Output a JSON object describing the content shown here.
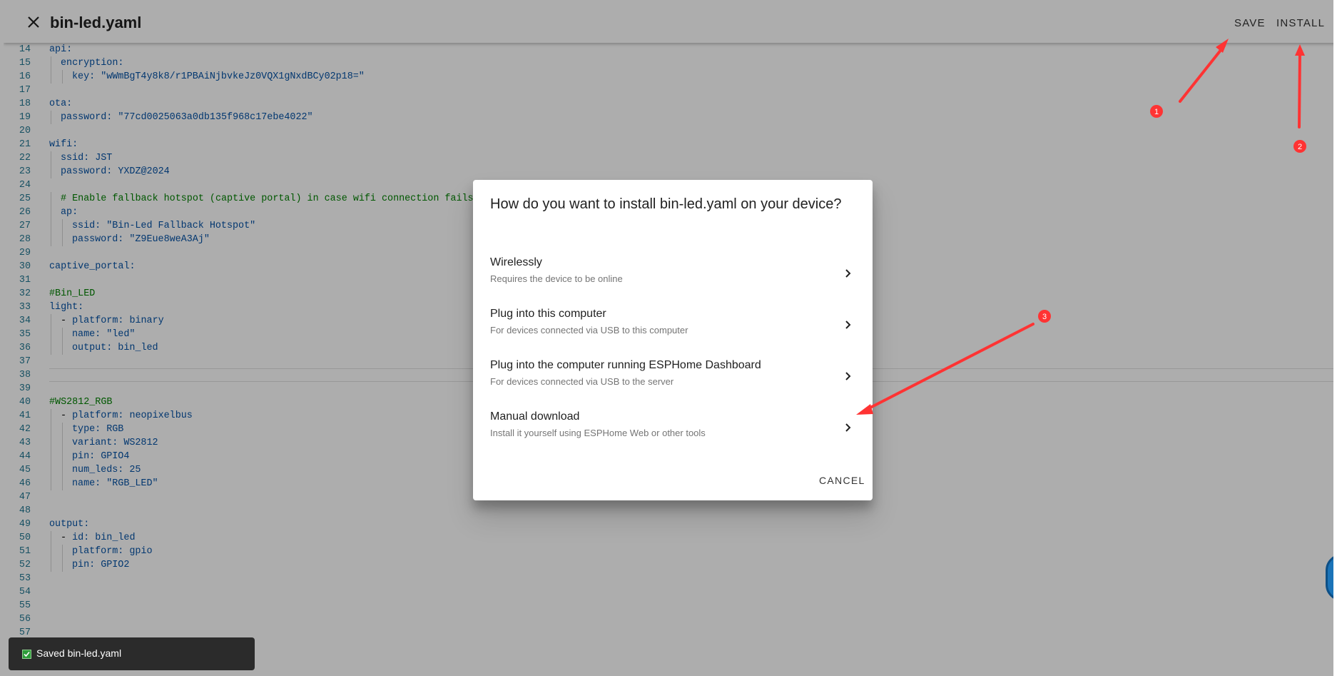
{
  "header": {
    "close_icon": "close-icon",
    "title": "bin-led.yaml",
    "save_label": "SAVE",
    "install_label": "INSTALL"
  },
  "editor": {
    "lines": [
      {
        "n": "14",
        "indent": 0,
        "parts": [
          {
            "t": "api:",
            "c": "k"
          }
        ]
      },
      {
        "n": "15",
        "indent": 1,
        "parts": [
          {
            "t": "encryption:",
            "c": "k"
          }
        ]
      },
      {
        "n": "16",
        "indent": 2,
        "parts": [
          {
            "t": "key: ",
            "c": "k"
          },
          {
            "t": "\"wWmBgT4y8k8/r1PBAiNjbvkeJz0VQX1gNxdBCy02p18=\"",
            "c": "s"
          }
        ]
      },
      {
        "n": "17",
        "indent": 0,
        "parts": []
      },
      {
        "n": "18",
        "indent": 0,
        "parts": [
          {
            "t": "ota:",
            "c": "k"
          }
        ]
      },
      {
        "n": "19",
        "indent": 1,
        "parts": [
          {
            "t": "password: ",
            "c": "k"
          },
          {
            "t": "\"77cd0025063a0db135f968c17ebe4022\"",
            "c": "s"
          }
        ]
      },
      {
        "n": "20",
        "indent": 0,
        "parts": []
      },
      {
        "n": "21",
        "indent": 0,
        "parts": [
          {
            "t": "wifi:",
            "c": "k"
          }
        ]
      },
      {
        "n": "22",
        "indent": 1,
        "parts": [
          {
            "t": "ssid: ",
            "c": "k"
          },
          {
            "t": "JST",
            "c": "s"
          }
        ]
      },
      {
        "n": "23",
        "indent": 1,
        "parts": [
          {
            "t": "password: ",
            "c": "k"
          },
          {
            "t": "YXDZ@2024",
            "c": "s"
          }
        ]
      },
      {
        "n": "24",
        "indent": 0,
        "parts": []
      },
      {
        "n": "25",
        "indent": 1,
        "parts": [
          {
            "t": "# Enable fallback hotspot (captive portal) in case wifi connection fails",
            "c": "c"
          }
        ]
      },
      {
        "n": "26",
        "indent": 1,
        "parts": [
          {
            "t": "ap:",
            "c": "k"
          }
        ]
      },
      {
        "n": "27",
        "indent": 2,
        "parts": [
          {
            "t": "ssid: ",
            "c": "k"
          },
          {
            "t": "\"Bin-Led Fallback Hotspot\"",
            "c": "s"
          }
        ]
      },
      {
        "n": "28",
        "indent": 2,
        "parts": [
          {
            "t": "password: ",
            "c": "k"
          },
          {
            "t": "\"Z9Eue8weA3Aj\"",
            "c": "s"
          }
        ]
      },
      {
        "n": "29",
        "indent": 0,
        "parts": []
      },
      {
        "n": "30",
        "indent": 0,
        "parts": [
          {
            "t": "captive_portal:",
            "c": "k"
          }
        ]
      },
      {
        "n": "31",
        "indent": 0,
        "parts": []
      },
      {
        "n": "32",
        "indent": 0,
        "parts": [
          {
            "t": "#Bin_LED",
            "c": "c"
          }
        ]
      },
      {
        "n": "33",
        "indent": 0,
        "parts": [
          {
            "t": "light:",
            "c": "k"
          }
        ]
      },
      {
        "n": "34",
        "indent": 1,
        "parts": [
          {
            "t": "- ",
            "c": "p"
          },
          {
            "t": "platform: ",
            "c": "k"
          },
          {
            "t": "binary",
            "c": "s"
          }
        ]
      },
      {
        "n": "35",
        "indent": 2,
        "parts": [
          {
            "t": "name: ",
            "c": "k"
          },
          {
            "t": "\"led\"",
            "c": "s"
          }
        ]
      },
      {
        "n": "36",
        "indent": 2,
        "parts": [
          {
            "t": "output: ",
            "c": "k"
          },
          {
            "t": "bin_led",
            "c": "s"
          }
        ]
      },
      {
        "n": "37",
        "indent": 0,
        "parts": []
      },
      {
        "n": "38",
        "indent": 0,
        "parts": [],
        "current": true
      },
      {
        "n": "39",
        "indent": 0,
        "parts": []
      },
      {
        "n": "40",
        "indent": 0,
        "parts": [
          {
            "t": "#WS2812_RGB",
            "c": "c"
          }
        ]
      },
      {
        "n": "41",
        "indent": 1,
        "parts": [
          {
            "t": "- ",
            "c": "p"
          },
          {
            "t": "platform: ",
            "c": "k"
          },
          {
            "t": "neopixelbus",
            "c": "s"
          }
        ]
      },
      {
        "n": "42",
        "indent": 2,
        "parts": [
          {
            "t": "type: ",
            "c": "k"
          },
          {
            "t": "RGB",
            "c": "s"
          }
        ]
      },
      {
        "n": "43",
        "indent": 2,
        "parts": [
          {
            "t": "variant: ",
            "c": "k"
          },
          {
            "t": "WS2812",
            "c": "s"
          }
        ]
      },
      {
        "n": "44",
        "indent": 2,
        "parts": [
          {
            "t": "pin: ",
            "c": "k"
          },
          {
            "t": "GPIO4",
            "c": "s"
          }
        ]
      },
      {
        "n": "45",
        "indent": 2,
        "parts": [
          {
            "t": "num_leds: ",
            "c": "k"
          },
          {
            "t": "25",
            "c": "s"
          }
        ]
      },
      {
        "n": "46",
        "indent": 2,
        "parts": [
          {
            "t": "name: ",
            "c": "k"
          },
          {
            "t": "\"RGB_LED\"",
            "c": "s"
          }
        ]
      },
      {
        "n": "47",
        "indent": 0,
        "parts": []
      },
      {
        "n": "48",
        "indent": 0,
        "parts": []
      },
      {
        "n": "49",
        "indent": 0,
        "parts": [
          {
            "t": "output:",
            "c": "k"
          }
        ]
      },
      {
        "n": "50",
        "indent": 1,
        "parts": [
          {
            "t": "- ",
            "c": "p"
          },
          {
            "t": "id: ",
            "c": "k"
          },
          {
            "t": "bin_led",
            "c": "s"
          }
        ]
      },
      {
        "n": "51",
        "indent": 2,
        "parts": [
          {
            "t": "platform: ",
            "c": "k"
          },
          {
            "t": "gpio",
            "c": "s"
          }
        ]
      },
      {
        "n": "52",
        "indent": 2,
        "parts": [
          {
            "t": "pin: ",
            "c": "k"
          },
          {
            "t": "GPIO2",
            "c": "s"
          }
        ]
      },
      {
        "n": "53",
        "indent": 0,
        "parts": []
      },
      {
        "n": "54",
        "indent": 0,
        "parts": []
      },
      {
        "n": "55",
        "indent": 0,
        "parts": []
      },
      {
        "n": "56",
        "indent": 0,
        "parts": []
      },
      {
        "n": "57",
        "indent": 0,
        "parts": []
      }
    ]
  },
  "dialog": {
    "title": "How do you want to install bin-led.yaml on your device?",
    "options": [
      {
        "label": "Wirelessly",
        "sublabel": "Requires the device to be online",
        "icon": "chevron-right-icon"
      },
      {
        "label": "Plug into this computer",
        "sublabel": "For devices connected via USB to this computer",
        "icon": "chevron-right-icon"
      },
      {
        "label": "Plug into the computer running ESPHome Dashboard",
        "sublabel": "For devices connected via USB to the server",
        "icon": "chevron-right-icon"
      },
      {
        "label": "Manual download",
        "sublabel": "Install it yourself using ESPHome Web or other tools",
        "icon": "chevron-right-icon"
      }
    ],
    "cancel_label": "CANCEL"
  },
  "toast": {
    "icon": "check-icon",
    "text": "Saved bin-led.yaml"
  },
  "annotations": {
    "color": "#ff3333",
    "markers": [
      "1",
      "2",
      "3"
    ]
  }
}
